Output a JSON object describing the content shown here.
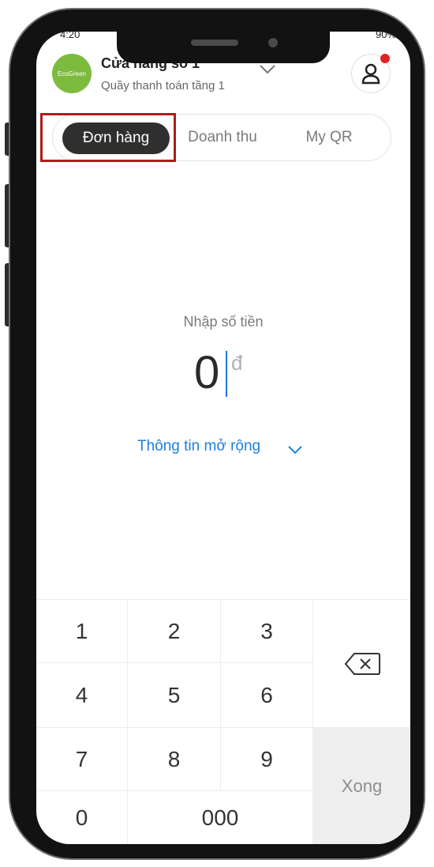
{
  "status": {
    "time": "4:20",
    "battery": "90%"
  },
  "header": {
    "logo_text": "EcoGreen",
    "store_name": "Cửa hàng số 1",
    "counter": "Quầy thanh toán tầng 1"
  },
  "tabs": [
    {
      "label": "Đơn hàng",
      "active": true
    },
    {
      "label": "Doanh thu",
      "active": false
    },
    {
      "label": "My QR",
      "active": false
    }
  ],
  "amount": {
    "label": "Nhập số tiền",
    "value": "0",
    "currency": "đ"
  },
  "more_info": "Thông tin mở rộng",
  "keypad": {
    "keys": [
      "1",
      "2",
      "3",
      "4",
      "5",
      "6",
      "7",
      "8",
      "9",
      "0",
      "000"
    ],
    "done": "Xong",
    "backspace_icon": "backspace-icon"
  },
  "colors": {
    "accent": "#1e7fe0",
    "active_tab": "#2f2f2f",
    "highlight_box": "#b01c1c",
    "notification_dot": "#e02424"
  }
}
